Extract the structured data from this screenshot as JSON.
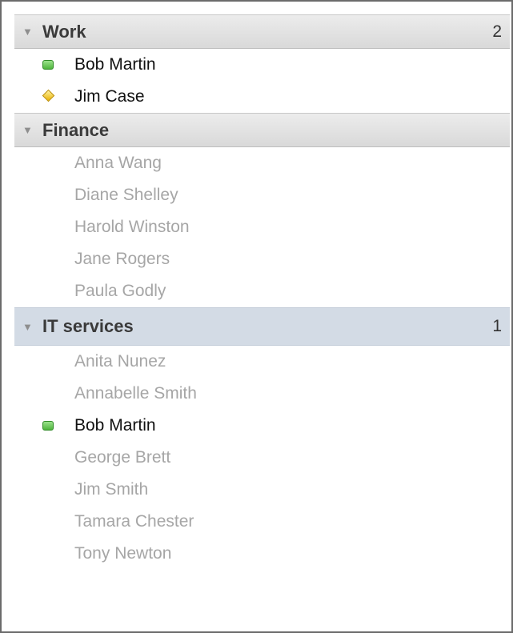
{
  "groups": [
    {
      "name": "Work",
      "count": "2",
      "selected": false,
      "contacts": [
        {
          "name": "Bob Martin",
          "status": "online"
        },
        {
          "name": "Jim Case",
          "status": "away"
        }
      ]
    },
    {
      "name": "Finance",
      "count": "",
      "selected": false,
      "contacts": [
        {
          "name": "Anna Wang",
          "status": "offline"
        },
        {
          "name": "Diane Shelley",
          "status": "offline"
        },
        {
          "name": "Harold Winston",
          "status": "offline"
        },
        {
          "name": "Jane Rogers",
          "status": "offline"
        },
        {
          "name": "Paula Godly",
          "status": "offline"
        }
      ]
    },
    {
      "name": "IT services",
      "count": "1",
      "selected": true,
      "contacts": [
        {
          "name": "Anita Nunez",
          "status": "offline"
        },
        {
          "name": "Annabelle Smith",
          "status": "offline"
        },
        {
          "name": "Bob Martin",
          "status": "online"
        },
        {
          "name": "George Brett",
          "status": "offline"
        },
        {
          "name": "Jim Smith",
          "status": "offline"
        },
        {
          "name": "Tamara Chester",
          "status": "offline"
        },
        {
          "name": "Tony Newton",
          "status": "offline"
        }
      ]
    }
  ],
  "icons": {
    "expanded": "chevron-down-icon",
    "online": "online-status-icon",
    "away": "away-status-icon"
  },
  "colors": {
    "online": "#4fb53d",
    "away": "#e8b000",
    "offline_text": "#a6a6a6",
    "selected_header": "#d3dbe5"
  }
}
